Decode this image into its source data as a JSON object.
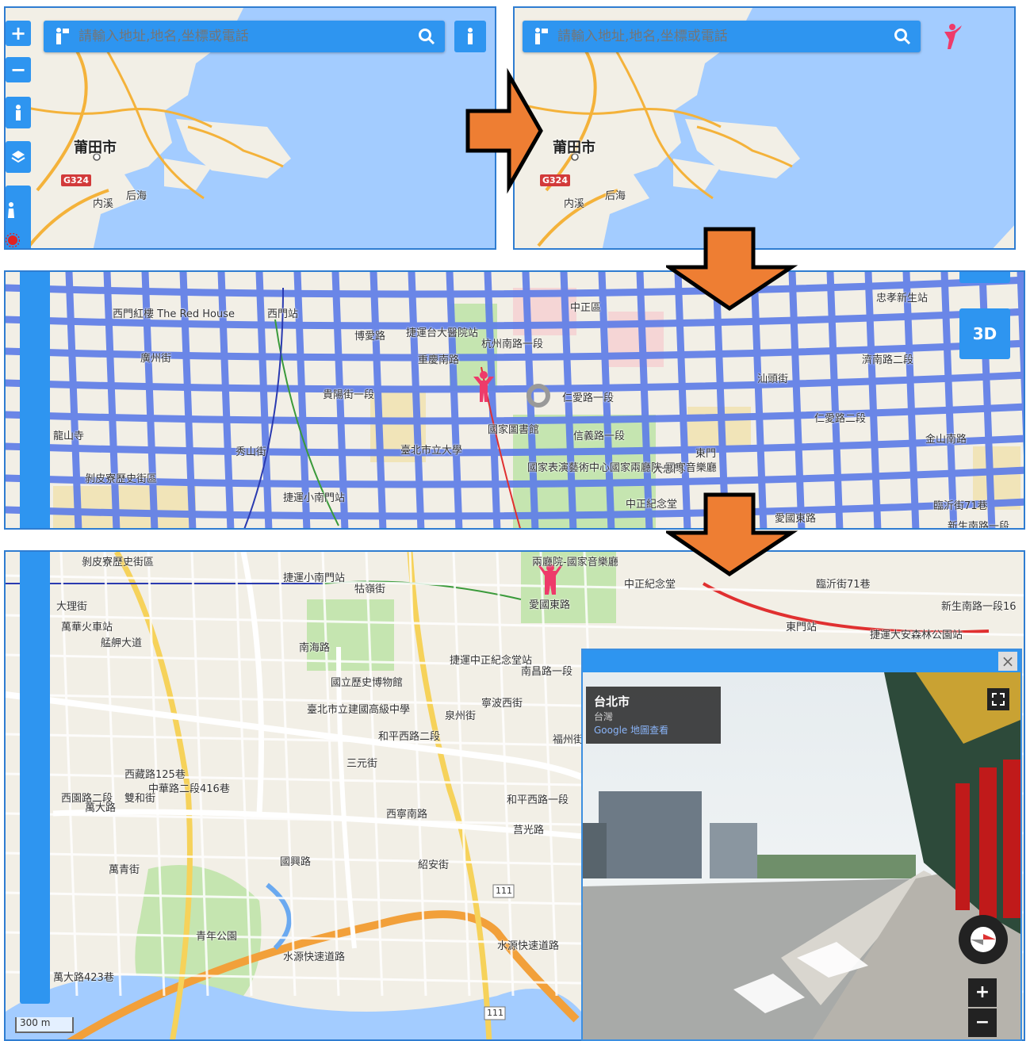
{
  "search": {
    "placeholder_top_left": "請輸入地址,地名,坐標或電話",
    "placeholder_top_right": "請輸入地址,地名,坐標或電話"
  },
  "panel1": {
    "zoom_in": "+",
    "zoom_out": "−",
    "city": "莆田市",
    "highway": "G324",
    "place_a": "内溪",
    "place_b": "后海"
  },
  "panel2": {
    "city": "莆田市",
    "highway": "G324",
    "place_a": "内溪",
    "place_b": "后海"
  },
  "panel3": {
    "labels": [
      "西門紅樓 The Red House",
      "西門站",
      "捷運台大醫院站",
      "中正區",
      "仁愛路一段",
      "仁愛路二段",
      "國家圖書館",
      "臺北市立大學",
      "國家表演藝術中心國家兩廳院-國家音樂廳",
      "大忠門",
      "剝皮寮歷史街區",
      "龍山寺",
      "捷運小南門站",
      "中正紀念堂",
      "貴陽街一段",
      "忠孝新生站",
      "愛國東路",
      "杭州南路一段",
      "東門",
      "新生南路一段",
      "濟南路二段",
      "信義路一段",
      "臨沂街71巷",
      "金山南路",
      "重慶南路",
      "廣州街",
      "汕頭街",
      "博愛路",
      "秀山街"
    ],
    "btn_3d": "3D"
  },
  "panel4": {
    "labels": [
      "剝皮寮歷史街區",
      "捷運小南門站",
      "兩廳院-國家音樂廳",
      "中正紀念堂",
      "愛國東路",
      "大理街",
      "萬華火車站",
      "艋舺大道",
      "東門站",
      "捷運大安森林公園站",
      "臨沂街71巷",
      "新生南路一段16",
      "捷運中正紀念堂站",
      "國立歷史博物館",
      "臺北市立建國高級中學",
      "南昌路一段",
      "寧波西街",
      "泉州街",
      "和平西路二段",
      "和平西路一段",
      "三元街",
      "中華路二段416巷",
      "西藏路125巷",
      "萬大路",
      "莒光路",
      "雙和街",
      "西園路二段",
      "國興路",
      "紹安街",
      "青年公園",
      "水源快速道路",
      "水源快速道路",
      "萬大路423巷",
      "西寧南路",
      "萬青街",
      "南海路",
      "牯嶺街",
      "福州街"
    ],
    "route_111_a": "111",
    "route_111_b": "111",
    "scale": "300 m"
  },
  "streetview": {
    "close": "×",
    "location": "台北市",
    "sublocation": "台灣",
    "source": "Google 地圖查看",
    "zoom_in": "+",
    "zoom_out": "−"
  },
  "colors": {
    "accent": "#2e95f0",
    "arrow": "#ee7e33",
    "water": "#a3ccff",
    "land": "#f2efe6",
    "road_overlay": "#5f7ee8",
    "pegman": "#ee3b6a"
  },
  "icons": [
    "plus-icon",
    "minus-icon",
    "pegman-icon",
    "layers-icon",
    "search-icon",
    "compass-icon",
    "fullscreen-icon",
    "red-sun-icon"
  ]
}
